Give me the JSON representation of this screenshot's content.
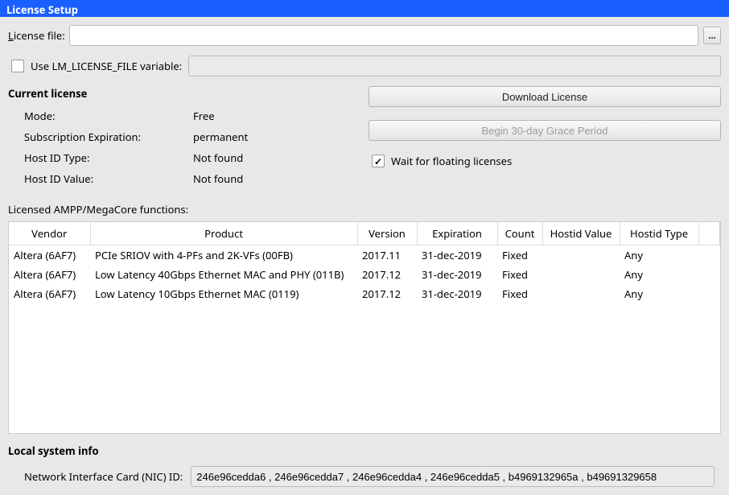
{
  "window": {
    "title": "License Setup"
  },
  "license_file": {
    "label_pre": "L",
    "label_post": "icense file:",
    "value": "",
    "browse_label": "..."
  },
  "lm_license": {
    "label": "Use LM_LICENSE_FILE variable:",
    "checked": false,
    "value": ""
  },
  "current_license": {
    "title": "Current license",
    "rows": {
      "mode_key": "Mode:",
      "mode_val": "Free",
      "sub_key": "Subscription Expiration:",
      "sub_val": "permanent",
      "hostidtype_key": "Host ID Type:",
      "hostidtype_val": "Not found",
      "hostidval_key": "Host ID Value:",
      "hostidval_val": "Not found"
    },
    "download_btn": "Download License",
    "grace_btn": "Begin 30-day Grace Period",
    "wait_label": "Wait for floating licenses",
    "wait_checked": true
  },
  "functions": {
    "title": "Licensed AMPP/MegaCore functions:",
    "columns": {
      "vendor": "Vendor",
      "product": "Product",
      "version": "Version",
      "expiration": "Expiration",
      "count": "Count",
      "hostid_value": "Hostid Value",
      "hostid_type": "Hostid Type"
    },
    "rows": [
      {
        "vendor": "Altera (6AF7)",
        "product": "PCIe SRIOV with 4-PFs and 2K-VFs (00FB)",
        "version": "2017.11",
        "expiration": "31-dec-2019",
        "count": "Fixed",
        "hostid_value": "",
        "hostid_type": "Any"
      },
      {
        "vendor": "Altera (6AF7)",
        "product": "Low Latency 40Gbps Ethernet MAC and PHY (011B)",
        "version": "2017.12",
        "expiration": "31-dec-2019",
        "count": "Fixed",
        "hostid_value": "",
        "hostid_type": "Any"
      },
      {
        "vendor": "Altera (6AF7)",
        "product": "Low Latency 10Gbps Ethernet MAC (0119)",
        "version": "2017.12",
        "expiration": "31-dec-2019",
        "count": "Fixed",
        "hostid_value": "",
        "hostid_type": "Any"
      }
    ]
  },
  "local": {
    "title": "Local system info",
    "nic_label": "Network Interface Card (NIC) ID:",
    "nic_value": "246e96cedda6 , 246e96cedda7 , 246e96cedda4 , 246e96cedda5 , b4969132965a , b49691329658"
  }
}
